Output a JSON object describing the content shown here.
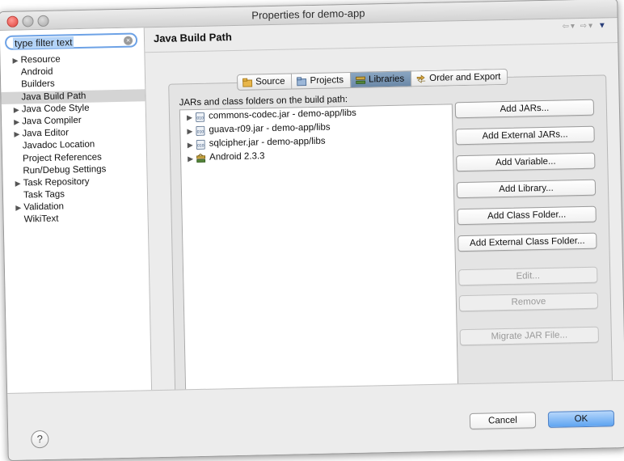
{
  "window": {
    "title": "Properties for demo-app"
  },
  "filter": {
    "value": "type filter text"
  },
  "tree": {
    "items": [
      {
        "label": "Resource",
        "expandable": true
      },
      {
        "label": "Android",
        "expandable": false
      },
      {
        "label": "Builders",
        "expandable": false
      },
      {
        "label": "Java Build Path",
        "expandable": false,
        "selected": true
      },
      {
        "label": "Java Code Style",
        "expandable": true
      },
      {
        "label": "Java Compiler",
        "expandable": true
      },
      {
        "label": "Java Editor",
        "expandable": true
      },
      {
        "label": "Javadoc Location",
        "expandable": false
      },
      {
        "label": "Project References",
        "expandable": false
      },
      {
        "label": "Run/Debug Settings",
        "expandable": false
      },
      {
        "label": "Task Repository",
        "expandable": true
      },
      {
        "label": "Task Tags",
        "expandable": false
      },
      {
        "label": "Validation",
        "expandable": true
      },
      {
        "label": "WikiText",
        "expandable": false
      }
    ]
  },
  "page": {
    "title": "Java Build Path"
  },
  "tabs": [
    {
      "label": "Source",
      "icon": "source-folder-icon",
      "active": false
    },
    {
      "label": "Projects",
      "icon": "projects-icon",
      "active": false
    },
    {
      "label": "Libraries",
      "icon": "libraries-icon",
      "active": true
    },
    {
      "label": "Order and Export",
      "icon": "order-export-icon",
      "active": false
    }
  ],
  "libraries": {
    "label": "JARs and class folders on the build path:",
    "items": [
      {
        "label": "commons-codec.jar - demo-app/libs",
        "icon": "jar-icon"
      },
      {
        "label": "guava-r09.jar - demo-app/libs",
        "icon": "jar-icon"
      },
      {
        "label": "sqlcipher.jar - demo-app/libs",
        "icon": "jar-icon"
      },
      {
        "label": "Android 2.3.3",
        "icon": "android-library-icon"
      }
    ]
  },
  "buttons": {
    "add_jars": "Add JARs...",
    "add_external_jars": "Add External JARs...",
    "add_variable": "Add Variable...",
    "add_library": "Add Library...",
    "add_class_folder": "Add Class Folder...",
    "add_external_class_folder": "Add External Class Folder...",
    "edit": "Edit...",
    "remove": "Remove",
    "migrate_jar": "Migrate JAR File..."
  },
  "footer": {
    "help": "?",
    "cancel": "Cancel",
    "ok": "OK"
  },
  "colors": {
    "accent": "#5ea4f1",
    "selection": "#d4d4d4",
    "active_tab": "#6b88a7",
    "close_button": "#e0443e"
  }
}
